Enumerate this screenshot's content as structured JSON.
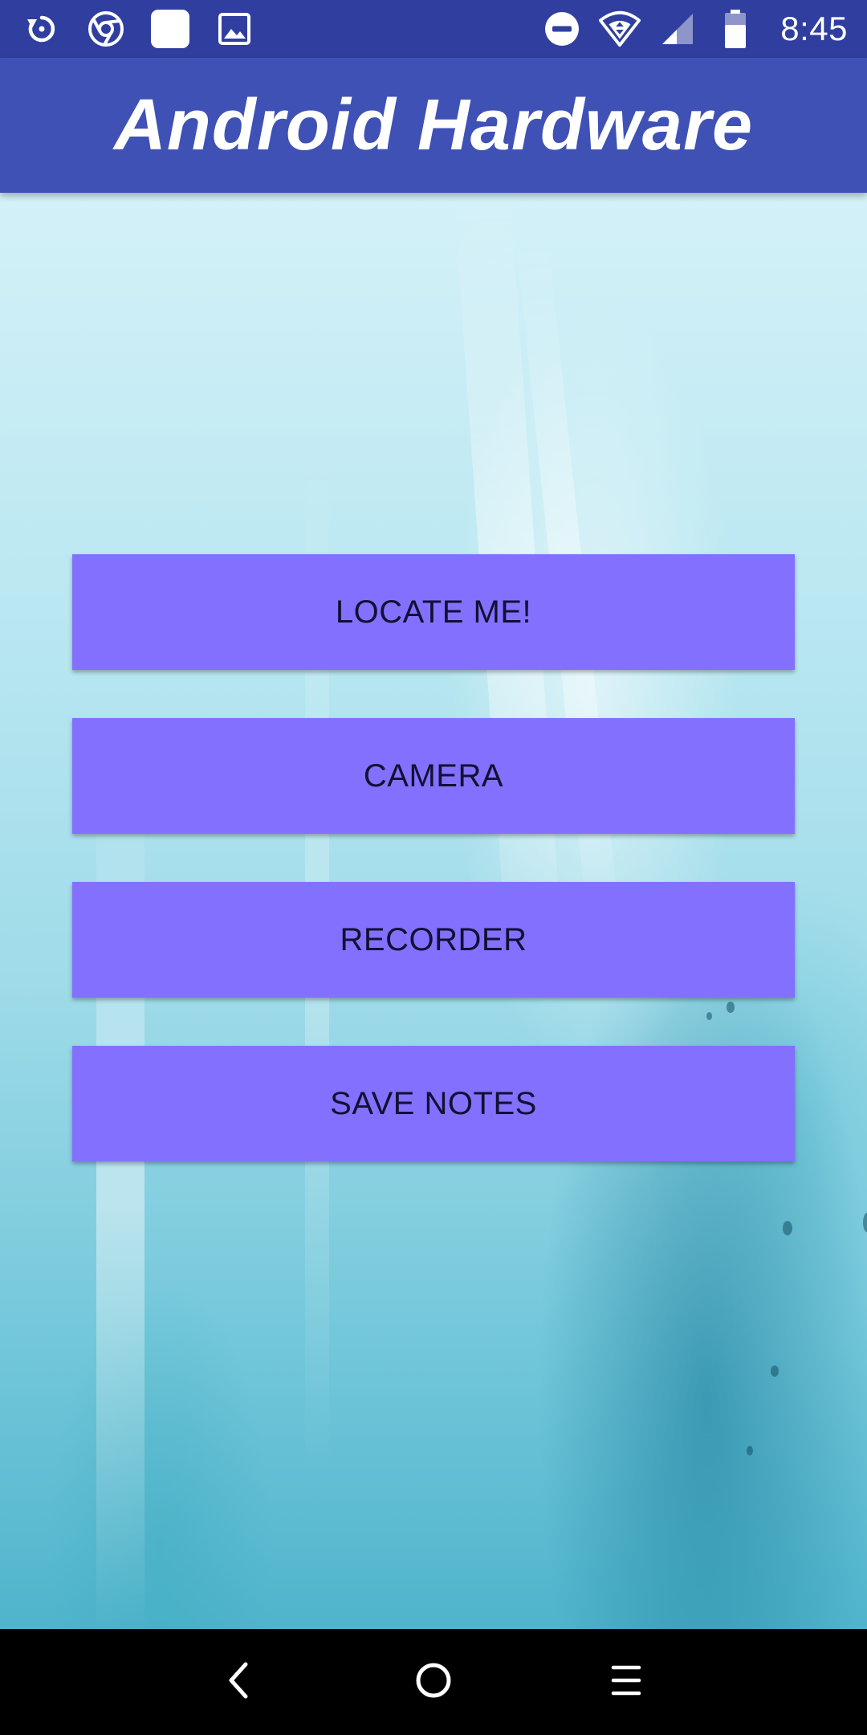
{
  "status_bar": {
    "time": "8:45",
    "left_icons": [
      "sync-icon",
      "chrome-icon",
      "blank-app-icon",
      "gallery-icon"
    ],
    "right_icons": [
      "do-not-disturb-icon",
      "wifi-icon",
      "signal-icon",
      "battery-icon"
    ],
    "background_color": "#303f9f"
  },
  "app_bar": {
    "title": "Android Hardware",
    "background_color": "#3f51b5"
  },
  "buttons": [
    {
      "label": "LOCATE ME!"
    },
    {
      "label": "CAMERA"
    },
    {
      "label": "RECORDER"
    },
    {
      "label": "SAVE NOTES"
    }
  ],
  "button_color": "#8470ff",
  "nav_bar": {
    "icons": [
      "back-icon",
      "home-icon",
      "recents-icon"
    ],
    "background_color": "#000000"
  }
}
